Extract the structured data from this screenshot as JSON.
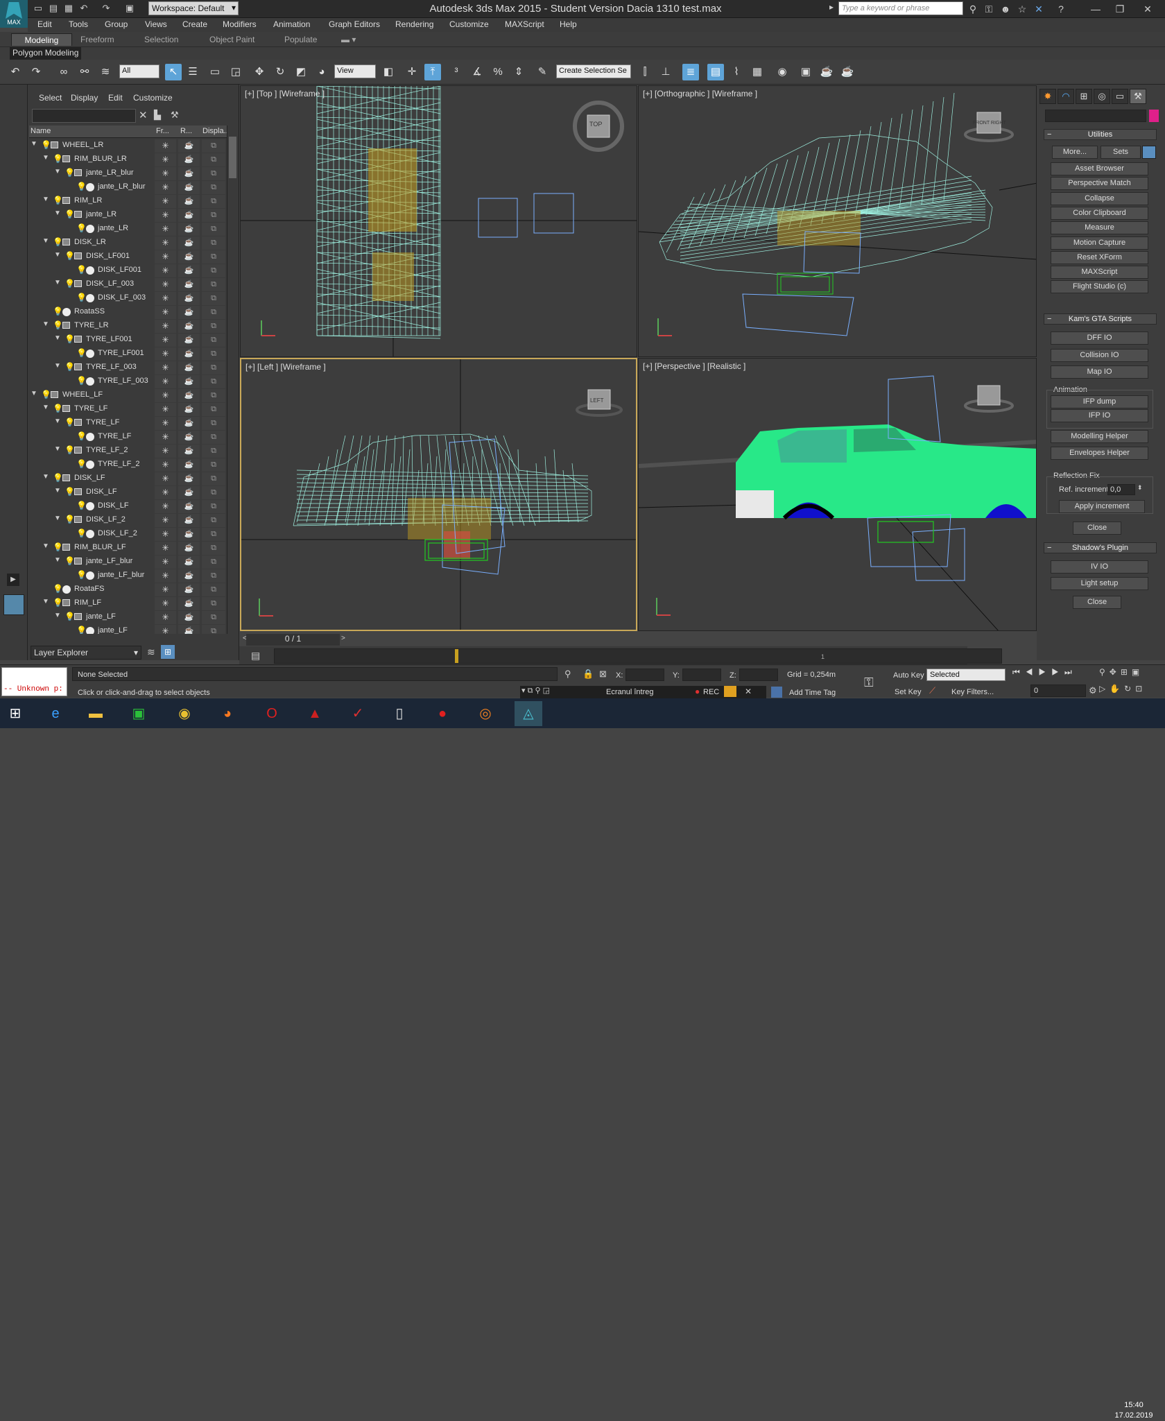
{
  "app": {
    "logo_text": "MAX",
    "workspace": "Workspace: Default",
    "title": "Autodesk 3ds Max  2015  - Student Version    Dacia 1310 test.max",
    "search_placeholder": "Type a keyword or phrase"
  },
  "menu": [
    "Edit",
    "Tools",
    "Group",
    "Views",
    "Create",
    "Modifiers",
    "Animation",
    "Graph Editors",
    "Rendering",
    "Customize",
    "MAXScript",
    "Help"
  ],
  "ribbon": {
    "tabs": [
      "Modeling",
      "Freeform",
      "Selection",
      "Object Paint",
      "Populate"
    ],
    "active_tab": "Modeling",
    "sub_label": "Polygon Modeling"
  },
  "toolbar": {
    "filter": "All",
    "coord": "View",
    "selection_set": "Create Selection Se"
  },
  "scene_explorer": {
    "menu": [
      "Select",
      "Display",
      "Edit",
      "Customize"
    ],
    "columns": [
      "Name",
      "Fr...",
      "R...",
      "Displa..."
    ],
    "rows": [
      {
        "name": "WHEEL_LR",
        "level": 0,
        "type": "layer",
        "exp": true
      },
      {
        "name": "RIM_BLUR_LR",
        "level": 1,
        "type": "layer",
        "exp": true
      },
      {
        "name": "jante_LR_blur",
        "level": 2,
        "type": "layer",
        "exp": true
      },
      {
        "name": "jante_LR_blur",
        "level": 3,
        "type": "obj"
      },
      {
        "name": "RIM_LR",
        "level": 1,
        "type": "layer",
        "exp": true
      },
      {
        "name": "jante_LR",
        "level": 2,
        "type": "layer",
        "exp": true
      },
      {
        "name": "jante_LR",
        "level": 3,
        "type": "obj"
      },
      {
        "name": "DISK_LR",
        "level": 1,
        "type": "layer",
        "exp": true
      },
      {
        "name": "DISK_LF001",
        "level": 2,
        "type": "layer",
        "exp": true
      },
      {
        "name": "DISK_LF001",
        "level": 3,
        "type": "obj"
      },
      {
        "name": "DISK_LF_003",
        "level": 2,
        "type": "layer",
        "exp": true
      },
      {
        "name": "DISK_LF_003",
        "level": 3,
        "type": "obj"
      },
      {
        "name": "RoataSS",
        "level": 1,
        "type": "obj"
      },
      {
        "name": "TYRE_LR",
        "level": 1,
        "type": "layer",
        "exp": true
      },
      {
        "name": "TYRE_LF001",
        "level": 2,
        "type": "layer",
        "exp": true
      },
      {
        "name": "TYRE_LF001",
        "level": 3,
        "type": "obj"
      },
      {
        "name": "TYRE_LF_003",
        "level": 2,
        "type": "layer",
        "exp": true
      },
      {
        "name": "TYRE_LF_003",
        "level": 3,
        "type": "obj"
      },
      {
        "name": "WHEEL_LF",
        "level": 0,
        "type": "layer",
        "exp": true
      },
      {
        "name": "TYRE_LF",
        "level": 1,
        "type": "layer",
        "exp": true
      },
      {
        "name": "TYRE_LF",
        "level": 2,
        "type": "layer",
        "exp": true
      },
      {
        "name": "TYRE_LF",
        "level": 3,
        "type": "obj"
      },
      {
        "name": "TYRE_LF_2",
        "level": 2,
        "type": "layer",
        "exp": true
      },
      {
        "name": "TYRE_LF_2",
        "level": 3,
        "type": "obj"
      },
      {
        "name": "DISK_LF",
        "level": 1,
        "type": "layer",
        "exp": true
      },
      {
        "name": "DISK_LF",
        "level": 2,
        "type": "layer",
        "exp": true
      },
      {
        "name": "DISK_LF",
        "level": 3,
        "type": "obj"
      },
      {
        "name": "DISK_LF_2",
        "level": 2,
        "type": "layer",
        "exp": true
      },
      {
        "name": "DISK_LF_2",
        "level": 3,
        "type": "obj"
      },
      {
        "name": "RIM_BLUR_LF",
        "level": 1,
        "type": "layer",
        "exp": true
      },
      {
        "name": "jante_LF_blur",
        "level": 2,
        "type": "layer",
        "exp": true
      },
      {
        "name": "jante_LF_blur",
        "level": 3,
        "type": "obj"
      },
      {
        "name": "RoataFS",
        "level": 1,
        "type": "obj"
      },
      {
        "name": "RIM_LF",
        "level": 1,
        "type": "layer",
        "exp": true
      },
      {
        "name": "jante_LF",
        "level": 2,
        "type": "layer",
        "exp": true
      },
      {
        "name": "jante_LF",
        "level": 3,
        "type": "obj"
      }
    ],
    "layer_explorer": "Layer Explorer"
  },
  "viewports": {
    "top": "[+] [Top ] [Wireframe ]",
    "ortho": "[+] [Orthographic ] [Wireframe ]",
    "left": "[+] [Left ] [Wireframe ]",
    "persp": "[+] [Perspective ] [Realistic ]",
    "cube_top": "TOP",
    "cube_left": "LEFT",
    "cube_ortho": "FRONT RIGHT",
    "wire_color": "#9ef0e0",
    "car_color": "#28e888"
  },
  "command_panel": {
    "utilities": "Utilities",
    "more": "More...",
    "sets": "Sets",
    "utility_buttons": [
      "Asset Browser",
      "Perspective Match",
      "Collapse",
      "Color Clipboard",
      "Measure",
      "Motion Capture",
      "Reset XForm",
      "MAXScript",
      "Flight Studio (c)"
    ],
    "kam_title": "Kam's GTA Scripts",
    "kam_buttons": [
      "DFF IO",
      "Collision IO",
      "Map IO"
    ],
    "animation_group": "Animation",
    "anim_buttons": [
      "IFP dump",
      "IFP IO"
    ],
    "helper_buttons": [
      "Modelling Helper",
      "Envelopes Helper"
    ],
    "reflection_group": "Reflection Fix",
    "ref_increment_label": "Ref. increment",
    "ref_increment_value": "0,0",
    "apply": "Apply increment",
    "close": "Close",
    "shadow_title": "Shadow's Plugin",
    "shadow_buttons": [
      "IV IO",
      "Light setup"
    ],
    "close2": "Close"
  },
  "timeline": {
    "frame": "0 / 1",
    "tick": "1"
  },
  "status": {
    "maxscript_error": "-- Unknown p:",
    "selection": "None Selected",
    "prompt": "Click or click-and-drag to select objects",
    "x_label": "X:",
    "y_label": "Y:",
    "z_label": "Z:",
    "grid": "Grid = 0,254m",
    "auto_key": "Auto Key",
    "set_key": "Set Key",
    "selected": "Selected",
    "key_filters": "Key Filters...",
    "add_time_tag": "Add Time Tag",
    "screen_label": "Ecranul întreg",
    "rec": "REC",
    "frame_field": "0"
  },
  "taskbar": {
    "time": "15:40",
    "date": "17.02.2019"
  }
}
